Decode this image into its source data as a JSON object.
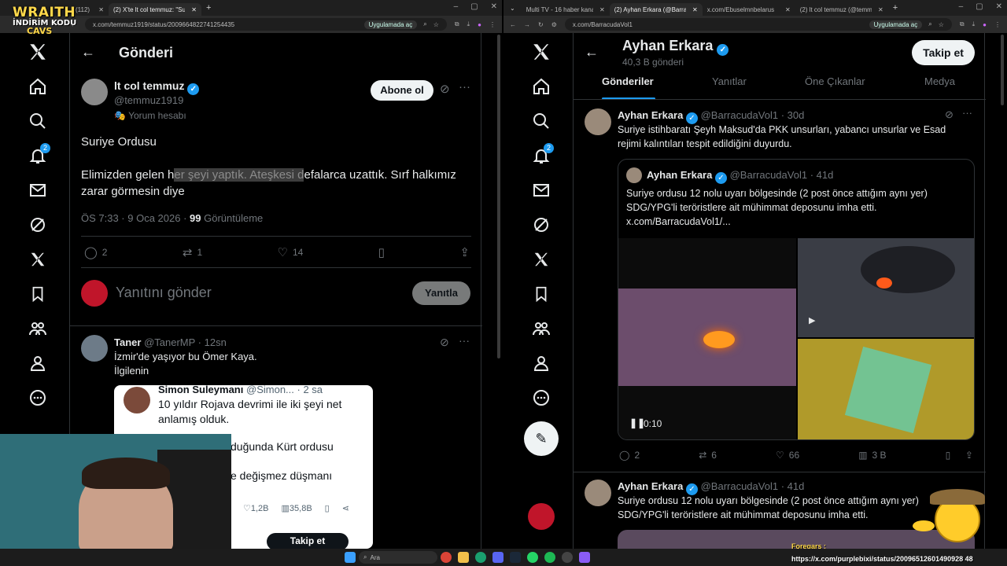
{
  "overlay": {
    "brand": "WRAITH",
    "promo_line1": "İNDİRİM KODU",
    "promo_line2": "CAVS",
    "foregars_label": "Foregars :",
    "foregars_url": "https://x.com/purplebixi/status/20096512601490928 48"
  },
  "left_browser": {
    "tabs": [
      {
        "label": "(112)",
        "active": false
      },
      {
        "label": "(2) X'te lt col temmuz: \"Suriye O",
        "active": true
      }
    ],
    "url": "x.com/temmuz1919/status/2009664822741254435",
    "open_in_app": "Uygulamada aç"
  },
  "right_browser": {
    "tabs": [
      {
        "label": "Multi TV - 16 haber kanalını ay",
        "active": false
      },
      {
        "label": "(2) Ayhan Erkara (@BarracudaV",
        "active": true
      },
      {
        "label": "x.com/Ebuselmnbelarus",
        "active": false
      },
      {
        "label": "(2) lt col temmuz (@temmuz19",
        "active": false
      }
    ],
    "url": "x.com/BarracudaVol1",
    "open_in_app": "Uygulamada aç"
  },
  "nav_icons": [
    "x-logo-icon",
    "home-icon",
    "search-icon",
    "notifications-icon",
    "messages-icon",
    "grok-icon",
    "premium-x-icon",
    "bookmarks-icon",
    "communities-icon",
    "profile-icon",
    "more-icon"
  ],
  "notification_count": "2",
  "left_page": {
    "header_title": "Gönderi",
    "post": {
      "author_name": "lt col temmuz",
      "handle": "@temmuz1919",
      "account_tag": "Yorum hesabı",
      "subscribe_label": "Abone ol",
      "text_line1": "Suriye Ordusu",
      "text_line2_before": "Elimizden gelen h",
      "text_line2_highlight": "er şeyi yaptık. Ateşkesi d",
      "text_line2_after": "efalarca uzattık. Sırf halkımız",
      "text_line3": "zarar görmesin diye",
      "time": "ÖS 7:33 · 9 Oca 2026 · ",
      "views_count": "99",
      "views_label": " Görüntüleme",
      "replies": "2",
      "reposts": "1",
      "likes": "14"
    },
    "reply_box": {
      "placeholder": "Yanıtını gönder",
      "button": "Yanıtla"
    },
    "reply": {
      "author_name": "Taner",
      "handle": "@TanerMP",
      "time": "· 12sn",
      "text_line1": "İzmir'de yaşıyor bu Ömer Kaya.",
      "text_line2": "İlgilenin"
    },
    "embedded_card": {
      "author_name": "Simon Suleymanı",
      "handle": "@Simon...",
      "time": "· 2 sa",
      "text_line1": "10 yıldır Rojava devrimi ile iki şeyi net",
      "text_line2": "anlamış olduk.",
      "text_line3": "duğunda Kürt ordusu",
      "text_line4": "e değişmez düşmanı",
      "likes": "1,2B",
      "views": "35,8B",
      "follow_label": "Takip et"
    }
  },
  "right_page": {
    "profile_name": "Ayhan Erkara",
    "post_count": "40,3 B gönderi",
    "follow_label": "Takip et",
    "tabs": [
      "Gönderiler",
      "Yanıtlar",
      "Öne Çıkanlar",
      "Medya"
    ],
    "post1": {
      "author_name": "Ayhan Erkara",
      "handle": "@BarracudaVol1",
      "time": "· 30d",
      "text_line1": "Suriye istihbaratı Şeyh Maksud'da PKK unsurları, yabancı unsurlar ve Esad",
      "text_line2": "rejimi kalıntıları tespit edildiğini duyurdu.",
      "quote": {
        "author_name": "Ayhan Erkara",
        "handle": "@BarracudaVol1",
        "time": "· 41d",
        "text_line1": "Suriye ordusu 12 nolu uyarı bölgesinde (2 post önce attığım aynı yer)",
        "text_line2": "SDG/YPG'li teröristlere ait mühimmat deposunu imha etti.",
        "text_line3": "x.com/BarracudaVol1/...",
        "video_time": "0:10"
      },
      "replies": "2",
      "reposts": "6",
      "likes": "66",
      "views": "3 B"
    },
    "post2": {
      "author_name": "Ayhan Erkara",
      "handle": "@BarracudaVol1",
      "time": "· 41d",
      "text_line1": "Suriye ordusu 12 nolu uyarı bölgesinde (2 post önce attığım aynı yer)",
      "text_line2": "SDG/YPG'li teröristlere ait mühimmat deposunu imha etti."
    }
  },
  "taskbar": {
    "search_placeholder": "Ara"
  },
  "colors": {
    "accent": "#1d9bf0",
    "background": "#000000",
    "text": "#e7e9ea",
    "muted": "#71767b"
  }
}
